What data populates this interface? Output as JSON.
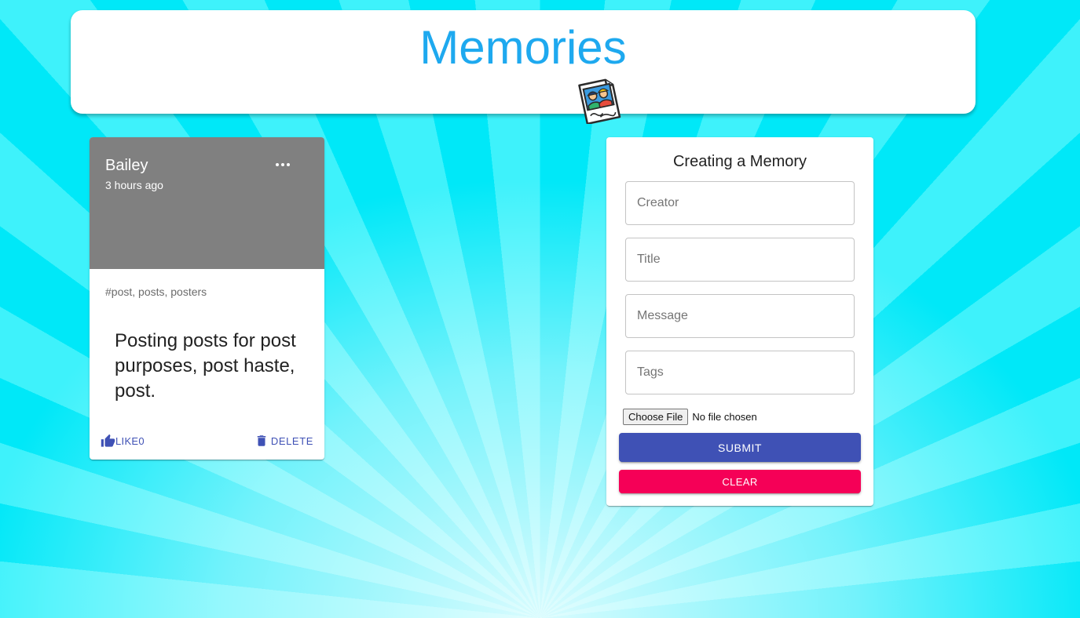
{
  "app": {
    "title": "Memories",
    "logo_icon": "photo-memories-icon",
    "title_color": "#1ea9ef",
    "background_color": "#00e8f8"
  },
  "posts": [
    {
      "creator": "Bailey",
      "time": "3 hours ago",
      "tags": "#post, posts, posters",
      "message": "Posting posts for post purposes, post haste, post.",
      "like_label": "LIKE",
      "like_count": "0",
      "delete_label": "DELETE",
      "media_color": "#808080"
    }
  ],
  "form": {
    "heading": "Creating a Memory",
    "creator_placeholder": "Creator",
    "title_placeholder": "Title",
    "message_placeholder": "Message",
    "tags_placeholder": "Tags",
    "file_button_label": "Choose File",
    "file_status": "No file chosen",
    "submit_label": "SUBMIT",
    "clear_label": "CLEAR",
    "submit_color": "#3f51b5",
    "clear_color": "#f50057"
  }
}
